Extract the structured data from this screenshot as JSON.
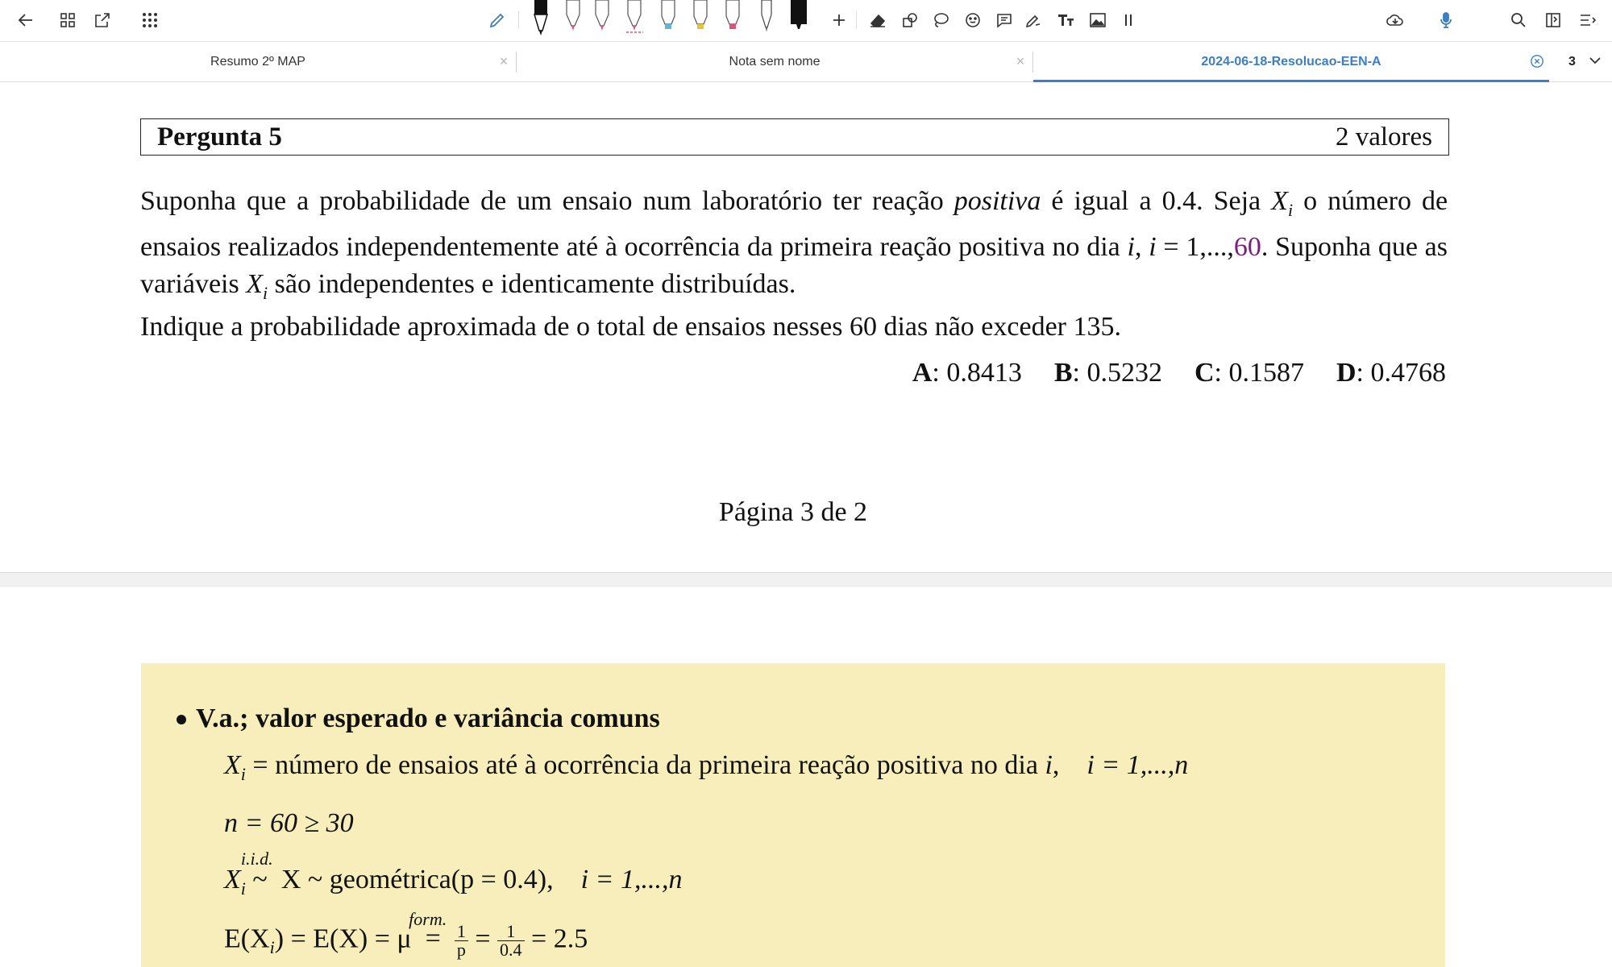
{
  "toolbar": {
    "pen_sizes": [
      "1",
      "1.2",
      "2.6",
      "2.5",
      "2.3",
      "2.3",
      "2.3",
      "6",
      "15"
    ],
    "pen_colors": [
      "#111111",
      "#e0527a",
      "#e0527a",
      "#e0527a",
      "#5fb8dc",
      "#e6c13a",
      "#e0527a",
      "#444444",
      "#111111"
    ],
    "accent": "#3b7ec4"
  },
  "tabs": [
    {
      "label": "Resumo 2º MAP",
      "active": false
    },
    {
      "label": "Nota sem nome",
      "active": false
    },
    {
      "label": "2024-06-18-Resolucao-EEN-A",
      "active": true
    }
  ],
  "page_count": "3",
  "question": {
    "title": "Pergunta 5",
    "points": "2 valores",
    "p1_a": "Suponha que a probabilidade de um ensaio num laboratório ter reação",
    "p1_italic": "positiva",
    "p1_b": "é igual a 0.4. Seja",
    "p1_var": "X",
    "p1_sub": "i",
    "p1_c": "o número de ensaios realizados independentemente até à ocorrência da primeira reação positiva no dia",
    "p1_i": "i",
    "p1_d": ",",
    "p1_range_a": "i",
    "p1_range_b": "= 1,...,",
    "p1_n": "60",
    "p1_e": ". Suponha que as variáveis",
    "p1_var2": "X",
    "p1_sub2": "i",
    "p1_f": "são independentes e identicamente distribuídas.",
    "p2": "Indique a probabilidade aproximada de o total de ensaios nesses 60 dias não exceder 135.",
    "options": [
      {
        "letter": "A",
        "value": ": 0.8413"
      },
      {
        "letter": "B",
        "value": ": 0.5232"
      },
      {
        "letter": "C",
        "value": ": 0.1587"
      },
      {
        "letter": "D",
        "value": ": 0.4768"
      }
    ]
  },
  "footer": "Página 3 de 2",
  "note": {
    "bullet": "V.a.; valor esperado e variância comuns",
    "l1_text": "= número de ensaios até à ocorrência da primeira reação positiva no dia",
    "l1_range": "i = 1,...,n",
    "l2": "n = 60 ≥ 30",
    "l3_iid": "i.i.d.",
    "l3_dist": "X ~ geométrica(p = 0.4),",
    "l3_range": "i = 1,...,n",
    "l4_left": "E(X",
    "l4_mid": ") = E(X) = μ",
    "l4_form": "form.",
    "l4_frac1_num": "1",
    "l4_frac1_den": "p",
    "l4_frac2_num": "1",
    "l4_frac2_den": "0.4",
    "l4_result": "= 2.5"
  }
}
